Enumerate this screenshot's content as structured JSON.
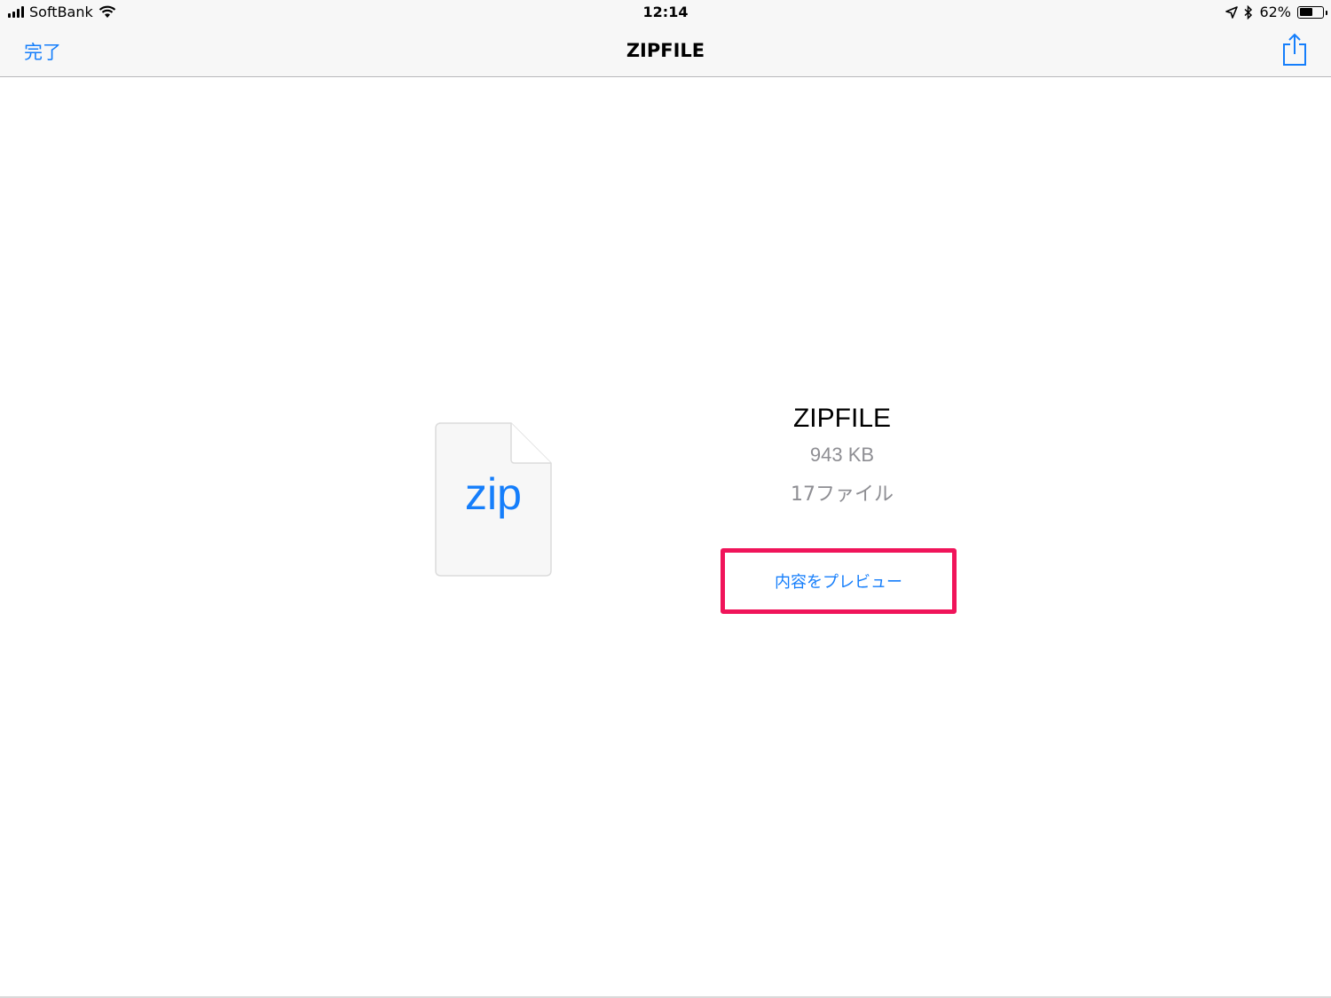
{
  "status_bar": {
    "carrier": "SoftBank",
    "time": "12:14",
    "battery_text": "62%",
    "battery_level": 0.62
  },
  "nav": {
    "done_label": "完了",
    "title": "ZIPFILE"
  },
  "file": {
    "icon_ext": "zip",
    "name": "ZIPFILE",
    "size": "943 KB",
    "count": "17ファイル"
  },
  "actions": {
    "preview_label": "内容をプレビュー"
  },
  "colors": {
    "accent": "#157efb",
    "highlight": "#f0145a",
    "secondary_text": "#8e8e93"
  },
  "icons": [
    "signal-icon",
    "wifi-icon",
    "location-arrow-icon",
    "bluetooth-icon",
    "battery-icon",
    "share-icon",
    "zip-file-icon"
  ]
}
